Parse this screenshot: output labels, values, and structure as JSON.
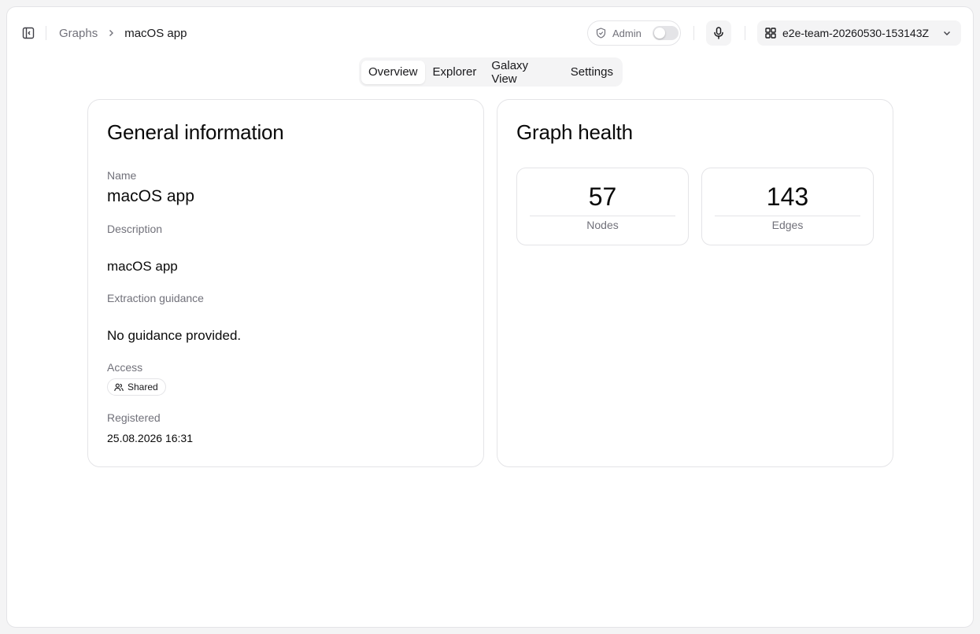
{
  "header": {
    "breadcrumb": {
      "parent": "Graphs",
      "current": "macOS app"
    },
    "admin_label": "Admin",
    "team_name": "e2e-team-20260530-153143Z"
  },
  "tabs": [
    {
      "label": "Overview",
      "active": true
    },
    {
      "label": "Explorer",
      "active": false
    },
    {
      "label": "Galaxy View",
      "active": false
    },
    {
      "label": "Settings",
      "active": false
    }
  ],
  "general": {
    "title": "General information",
    "name_label": "Name",
    "name_value": "macOS app",
    "description_label": "Description",
    "description_value": "macOS app",
    "guidance_label": "Extraction guidance",
    "guidance_value": "No guidance provided.",
    "access_label": "Access",
    "access_value": "Shared",
    "registered_label": "Registered",
    "registered_value": "25.08.2026 16:31"
  },
  "health": {
    "title": "Graph health",
    "metrics": [
      {
        "value": "57",
        "label": "Nodes"
      },
      {
        "value": "143",
        "label": "Edges"
      }
    ]
  },
  "colors": {
    "border": "#e4e4e7",
    "muted_text": "#71717a",
    "text": "#0a0a0a",
    "surface": "#f4f4f5"
  }
}
